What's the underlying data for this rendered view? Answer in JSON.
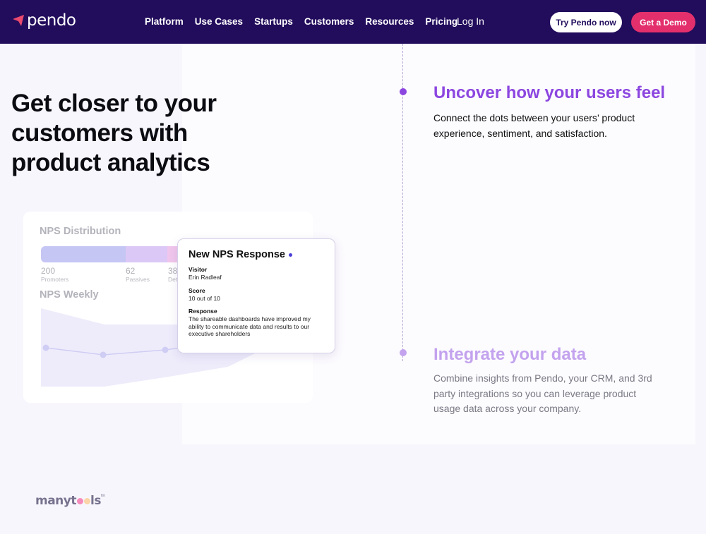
{
  "nav": {
    "logo": "pendo",
    "items": [
      "Platform",
      "Use Cases",
      "Startups",
      "Customers",
      "Resources",
      "Pricing"
    ],
    "login": "Log In",
    "try_button": "Try Pendo now",
    "demo_button": "Get a Demo"
  },
  "hero": {
    "title": "Get closer to your customers with product analytics"
  },
  "features": [
    {
      "title": "Uncover how your users feel",
      "text": "Connect the dots between your users’ product experience, sentiment, and satisfaction."
    },
    {
      "title": "Integrate your data",
      "text": "Combine insights from Pendo, your CRM, and 3rd party integrations so you can leverage product usage data across your company."
    }
  ],
  "card": {
    "dist_title": "NPS Distribution",
    "weekly_title": "NPS Weekly",
    "segments": [
      {
        "value": "200",
        "label": "Promoters",
        "color": "#c5c6f4"
      },
      {
        "value": "62",
        "label": "Passives",
        "color": "#dcc8f6"
      },
      {
        "value": "38",
        "label": "Detractors",
        "color": "#f0c6ec"
      }
    ]
  },
  "popup": {
    "title": "New NPS Response",
    "visitor_label": "Visitor",
    "visitor": "Erin Radleaf",
    "score_label": "Score",
    "score": "10 out of 10",
    "response_label": "Response",
    "response": "The shareable dashboards have improved my ability to communicate data and results to our executive shareholders"
  },
  "watermark": {
    "text": "manytools",
    "tm": "tm"
  },
  "colors": {
    "nav": "#220c5c",
    "accent": "#8c46e0",
    "demo": "#e3306c"
  }
}
